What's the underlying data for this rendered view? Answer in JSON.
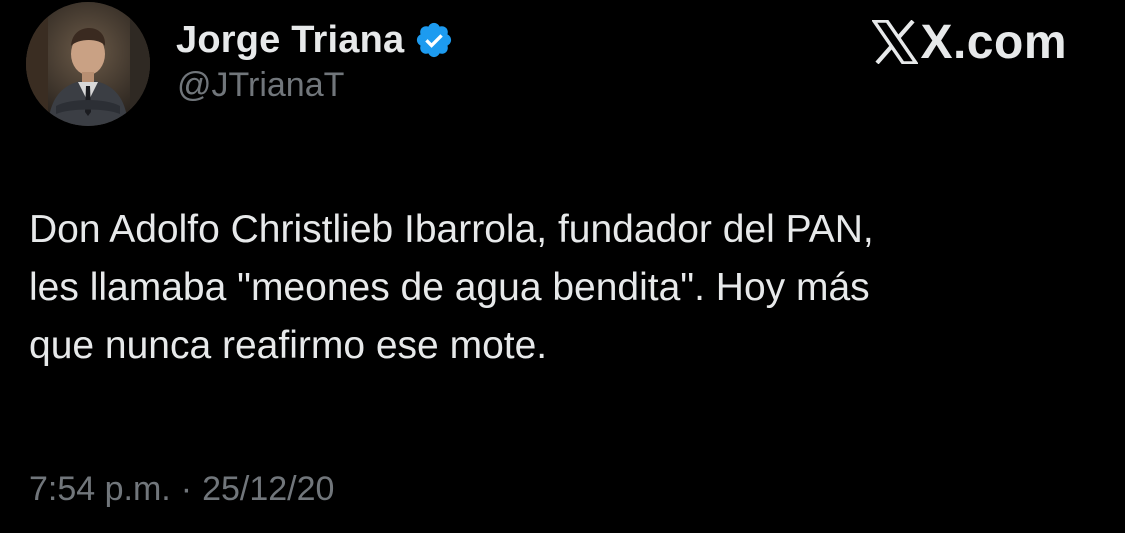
{
  "author": {
    "display_name": "Jorge Triana",
    "handle": "@JTrianaT",
    "verified": true,
    "avatar_icon": "profile-photo"
  },
  "brand": {
    "text": "X.com",
    "icon": "x-logo-icon"
  },
  "tweet": {
    "text": "Don Adolfo Christlieb Ibarrola, fundador del PAN,\nles llamaba \"meones de agua bendita\". Hoy más\nque nunca reafirmo ese mote.",
    "time": "7:54 p.m.",
    "separator": "·",
    "date": "25/12/20"
  },
  "colors": {
    "background": "#000000",
    "primary_text": "#e7e9ea",
    "secondary_text": "#71767b",
    "verified_badge": "#1d9bf0"
  }
}
